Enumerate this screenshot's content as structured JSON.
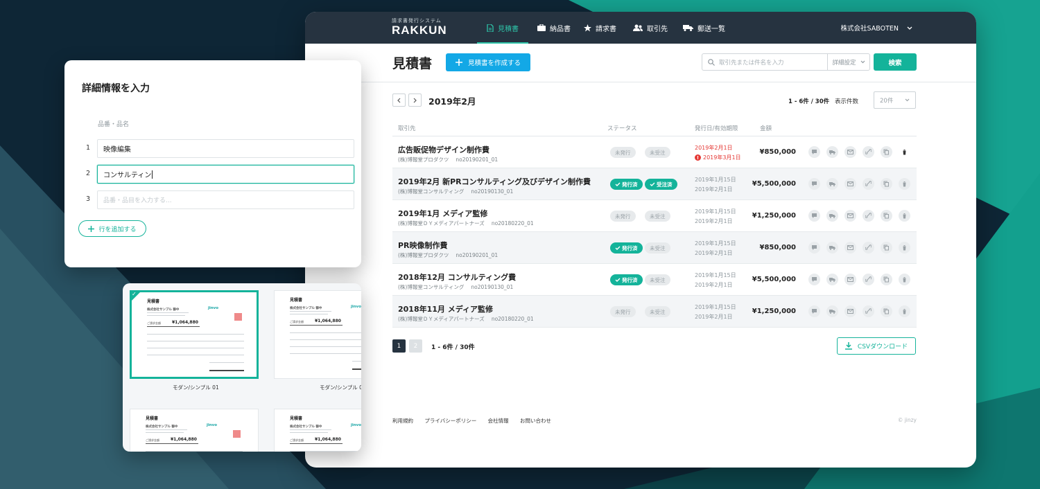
{
  "colors": {
    "accent": "#14b39a",
    "primary_button": "#13a8e6",
    "header_bg": "#263340",
    "danger": "#e53935"
  },
  "app": {
    "logo_subtitle": "請求書発行システム",
    "logo": "RAKKUN",
    "nav": [
      {
        "label": "見積書",
        "icon": "document-icon",
        "active": true
      },
      {
        "label": "納品書",
        "icon": "briefcase-icon",
        "active": false
      },
      {
        "label": "請求書",
        "icon": "star-icon",
        "active": false
      },
      {
        "label": "取引先",
        "icon": "users-icon",
        "active": false
      },
      {
        "label": "郵送一覧",
        "icon": "truck-icon",
        "active": false
      }
    ],
    "company": "株式会社SABOTEN"
  },
  "header": {
    "title": "見積書",
    "create_button": "見積書を作成する",
    "search_placeholder": "取引先または件名を入力",
    "detail_settings": "詳細設定",
    "search_button": "検索"
  },
  "list": {
    "month": "2019年2月",
    "count": "1 - 6件 / 30件",
    "per_page_label": "表示件数",
    "per_page_value": "20件",
    "columns": {
      "client": "取引先",
      "status": "ステータス",
      "date": "発行日/有効期限",
      "amount": "金額"
    },
    "status_labels": {
      "unissued": "未発行",
      "issued": "発行済",
      "not_ordered": "未受注",
      "ordered": "受注済"
    },
    "rows": [
      {
        "name": "広告販促物デザイン制作費",
        "client": "(株)博報堂プロダクツ",
        "no": "no20190201_01",
        "issued": false,
        "ordered": false,
        "issue_date": "2019年2月1日",
        "expiry": "2019年3月1日",
        "overdue": true,
        "amount": "¥850,000"
      },
      {
        "name": "2019年2月 新PRコンサルティング及びデザイン制作費",
        "client": "(株)博報堂コンサルティング",
        "no": "no20190130_01",
        "issued": true,
        "ordered": true,
        "issue_date": "2019年1月15日",
        "expiry": "2019年2月1日",
        "overdue": false,
        "amount": "¥5,500,000"
      },
      {
        "name": "2019年1月 メディア監修",
        "client": "(株)博報堂ＤＹメディアパートナーズ",
        "no": "no20180220_01",
        "issued": false,
        "ordered": false,
        "issue_date": "2019年1月15日",
        "expiry": "2019年2月1日",
        "overdue": false,
        "amount": "¥1,250,000"
      },
      {
        "name": "PR映像制作費",
        "client": "(株)博報堂プロダクツ",
        "no": "no20190201_01",
        "issued": true,
        "ordered": false,
        "issue_date": "2019年1月15日",
        "expiry": "2019年2月1日",
        "overdue": false,
        "amount": "¥850,000"
      },
      {
        "name": "2018年12月 コンサルティング費",
        "client": "(株)博報堂コンサルティング",
        "no": "no20190130_01",
        "issued": true,
        "ordered": false,
        "issue_date": "2019年1月15日",
        "expiry": "2019年2月1日",
        "overdue": false,
        "amount": "¥5,500,000"
      },
      {
        "name": "2018年11月 メディア監修",
        "client": "(株)博報堂ＤＹメディアパートナーズ",
        "no": "no20180220_01",
        "issued": false,
        "ordered": false,
        "issue_date": "2019年1月15日",
        "expiry": "2019年2月1日",
        "overdue": false,
        "amount": "¥1,250,000"
      }
    ],
    "row_actions": [
      "comment-icon",
      "truck-icon",
      "mail-icon",
      "link-icon",
      "copy-icon",
      "trash-icon"
    ],
    "pagination": {
      "current": "1",
      "next": "2",
      "count": "1 - 6件 / 30件"
    },
    "csv_button": "CSVダウンロード"
  },
  "footer": {
    "links": [
      "利用規約",
      "プライバシーポリシー",
      "会社情報",
      "お問い合わせ"
    ],
    "copyright": "© jinzy"
  },
  "detail_card": {
    "title": "詳細情報を入力",
    "column_header": "品番・品名",
    "rows": [
      {
        "num": "1",
        "value": "映像編集"
      },
      {
        "num": "2",
        "value": "コンサルティン"
      },
      {
        "num": "3",
        "placeholder": "品番・品目を入力する..."
      }
    ],
    "add_row_button": "行を追加する"
  },
  "template_card": {
    "doc_title": "見積書",
    "doc_company": "株式会社サンプル 御中",
    "doc_logo": "jinvo",
    "doc_total_label": "ご請求金額",
    "doc_amount": "¥1,064,880",
    "captions": [
      "モダン/シンプル 01",
      "モダン/シンプル 0"
    ]
  }
}
